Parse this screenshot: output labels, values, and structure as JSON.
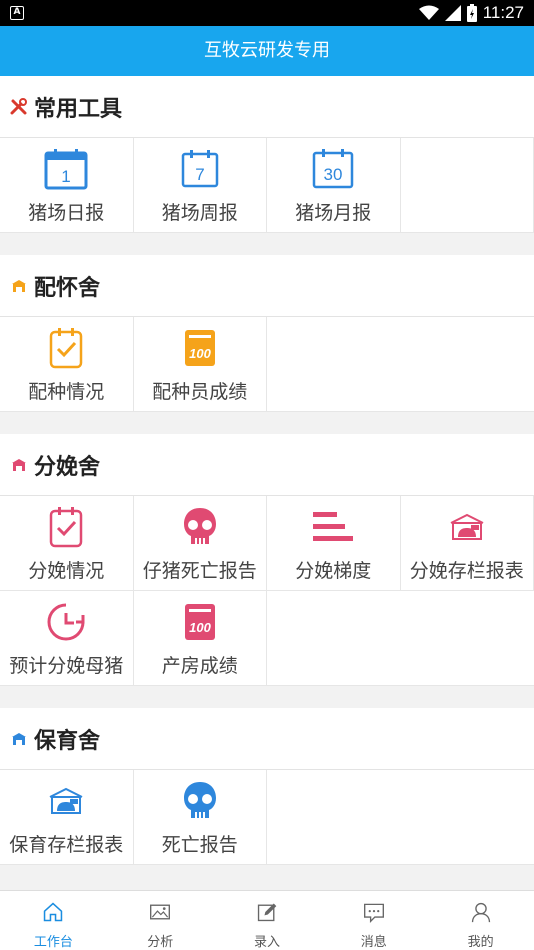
{
  "status_bar": {
    "time": "11:27",
    "app_badge": "A"
  },
  "header": {
    "title": "互牧云研发专用"
  },
  "colors": {
    "header": "#18a6ee",
    "tools": "#d9392d",
    "breeding": "#f5a31a",
    "farrowing": "#e04a72",
    "nursery": "#2e87dc",
    "tab_active": "#1a8de0"
  },
  "sections": [
    {
      "title": "常用工具",
      "icon": "tools-icon",
      "items": [
        {
          "label": "猪场日报",
          "icon": "calendar-day-icon",
          "num": "1"
        },
        {
          "label": "猪场周报",
          "icon": "calendar-week-icon",
          "num": "7"
        },
        {
          "label": "猪场月报",
          "icon": "calendar-month-icon",
          "num": "30"
        }
      ]
    },
    {
      "title": "配怀舍",
      "icon": "barn-icon",
      "items": [
        {
          "label": "配种情况",
          "icon": "clipboard-check-icon"
        },
        {
          "label": "配种员成绩",
          "icon": "score-100-icon",
          "score": "100"
        }
      ]
    },
    {
      "title": "分娩舍",
      "icon": "barn-icon",
      "items": [
        {
          "label": "分娩情况",
          "icon": "clipboard-check-icon"
        },
        {
          "label": "仔猪死亡报告",
          "icon": "skull-icon"
        },
        {
          "label": "分娩梯度",
          "icon": "bars-icon"
        },
        {
          "label": "分娩存栏报表",
          "icon": "pen-icon"
        },
        {
          "label": "预计分娩母猪",
          "icon": "clock-icon"
        },
        {
          "label": "产房成绩",
          "icon": "score-100-icon",
          "score": "100"
        }
      ]
    },
    {
      "title": "保育舍",
      "icon": "barn-icon",
      "items": [
        {
          "label": "保育存栏报表",
          "icon": "pen-icon"
        },
        {
          "label": "死亡报告",
          "icon": "skull-icon"
        }
      ]
    }
  ],
  "tabs": [
    {
      "label": "工作台",
      "icon": "home-icon",
      "active": true
    },
    {
      "label": "分析",
      "icon": "image-icon",
      "active": false
    },
    {
      "label": "录入",
      "icon": "edit-icon",
      "active": false
    },
    {
      "label": "消息",
      "icon": "message-icon",
      "active": false
    },
    {
      "label": "我的",
      "icon": "user-icon",
      "active": false
    }
  ]
}
